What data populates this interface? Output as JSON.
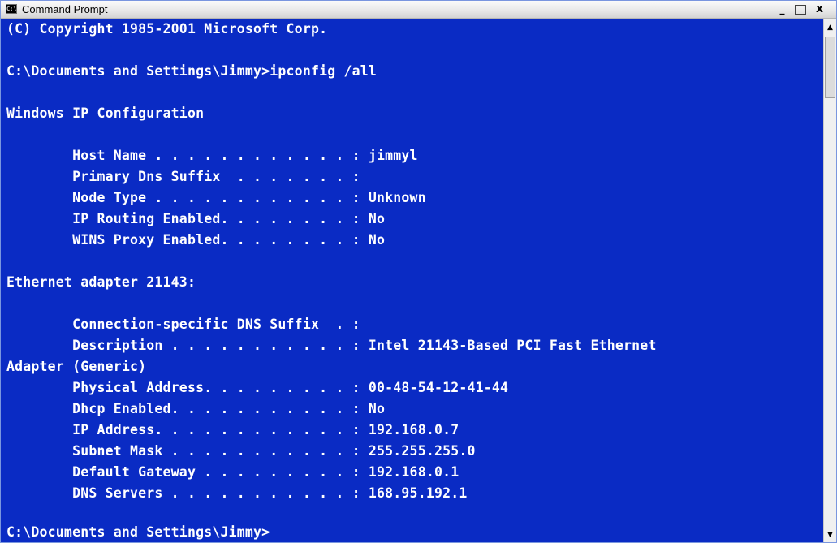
{
  "window": {
    "title": "Command Prompt",
    "icon": "cmd-app-icon",
    "icon_glyph": "C:\\",
    "controls": {
      "minimize": "_",
      "maximize": "",
      "close": "x"
    }
  },
  "console": {
    "lines": [
      "(C) Copyright 1985-2001 Microsoft Corp.",
      "",
      "C:\\Documents and Settings\\Jimmy>ipconfig /all",
      "",
      "Windows IP Configuration",
      "",
      "        Host Name . . . . . . . . . . . . : jimmyl",
      "        Primary Dns Suffix  . . . . . . . :",
      "        Node Type . . . . . . . . . . . . : Unknown",
      "        IP Routing Enabled. . . . . . . . : No",
      "        WINS Proxy Enabled. . . . . . . . : No",
      "",
      "Ethernet adapter 21143:",
      "",
      "        Connection-specific DNS Suffix  . :",
      "        Description . . . . . . . . . . . : Intel 21143-Based PCI Fast Ethernet",
      "Adapter (Generic)",
      "        Physical Address. . . . . . . . . : 00-48-54-12-41-44",
      "        Dhcp Enabled. . . . . . . . . . . : No",
      "        IP Address. . . . . . . . . . . . : 192.168.0.7",
      "        Subnet Mask . . . . . . . . . . . : 255.255.255.0",
      "        Default Gateway . . . . . . . . . : 192.168.0.1",
      "        DNS Servers . . . . . . . . . . . : 168.95.192.1",
      "",
      "C:\\Documents and Settings\\Jimmy>"
    ]
  },
  "scrollbar": {
    "up_arrow": "▲",
    "down_arrow": "▼"
  },
  "colors": {
    "console_background": "#0a2bc4",
    "console_text": "#ffffff",
    "titlebar": "#e7e7e7"
  }
}
